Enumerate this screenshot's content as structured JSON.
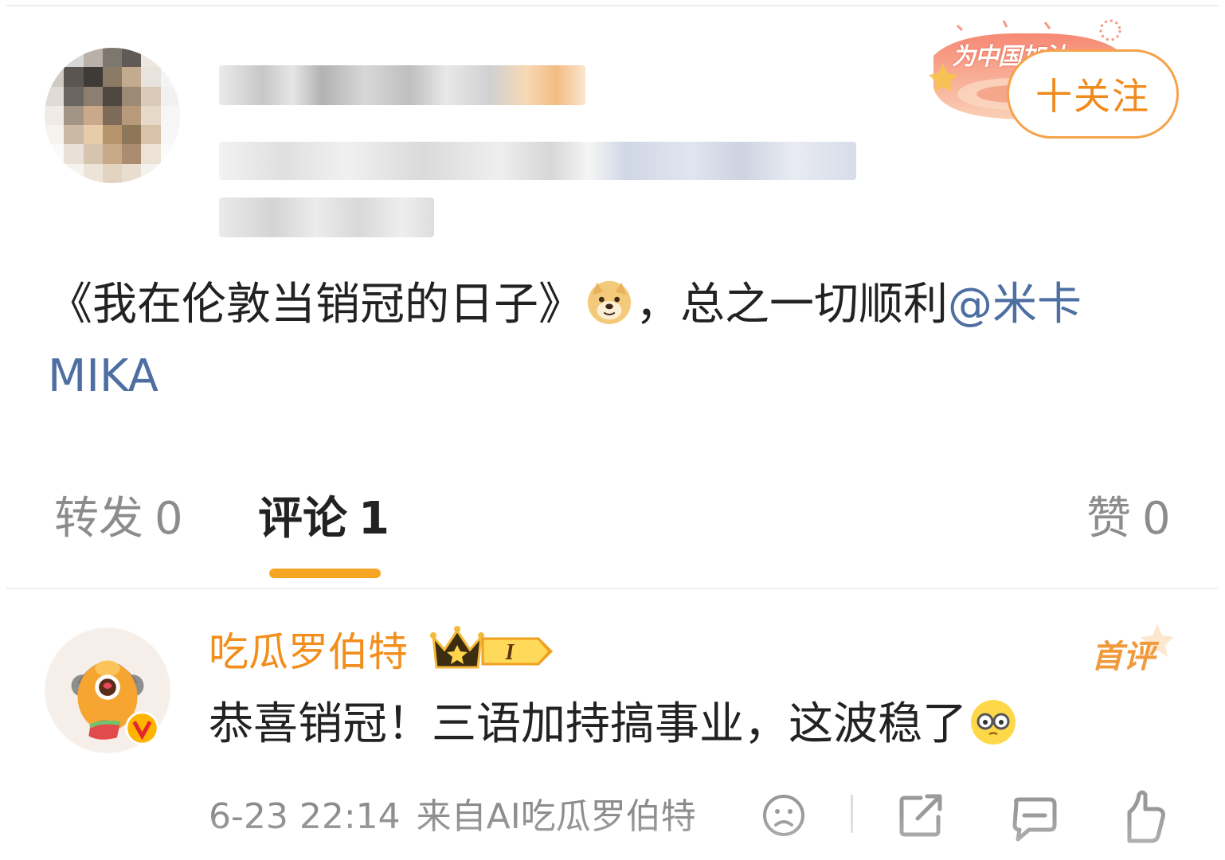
{
  "post": {
    "follow_label": "十关注",
    "decoration_text": "为中国加油",
    "text_parts": {
      "title": "《我在伦敦当销冠的日子》",
      "emoji": "doge-emoji",
      "after_emoji": "，总之一切顺利",
      "mention_first": "@米卡",
      "mention_second": "MIKA"
    }
  },
  "tabs": [
    {
      "label": "转发",
      "count": "0"
    },
    {
      "label": "评论",
      "count": "1"
    },
    {
      "label": "赞",
      "count": "0"
    }
  ],
  "colors": {
    "accent_orange": "#f28e1c",
    "tab_underline": "#f6a623",
    "mention_blue": "#4e6fa1",
    "muted_gray": "#8c8c8c"
  },
  "comment": {
    "username": "吃瓜罗伯特",
    "level_badge": "I",
    "first_comment_tag": "首评",
    "text": "恭喜销冠！三语加持搞事业，这波稳了",
    "emoji": "glasses-emoji",
    "time": "6-23 22:14",
    "source": "来自AI吃瓜罗伯特",
    "icons": [
      "sad-face-icon",
      "share-icon",
      "comment-icon",
      "like-icon"
    ]
  }
}
